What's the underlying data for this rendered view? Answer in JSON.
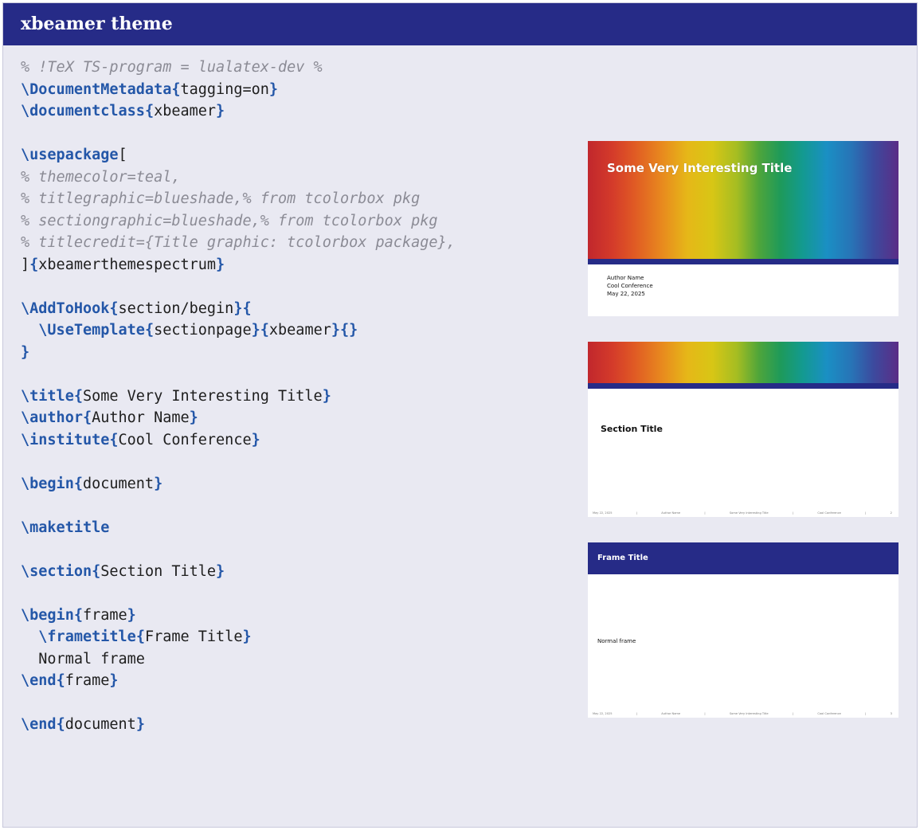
{
  "box": {
    "title": "xbeamer theme"
  },
  "code": {
    "lines": [
      [
        [
          "cm",
          "% !TeX TS-program = lualatex-dev %"
        ]
      ],
      [
        [
          "kw",
          "\\DocumentMetadata"
        ],
        [
          "br",
          "{"
        ],
        [
          "tx",
          "tagging=on"
        ],
        [
          "br",
          "}"
        ]
      ],
      [
        [
          "kw",
          "\\documentclass"
        ],
        [
          "br",
          "{"
        ],
        [
          "tx",
          "xbeamer"
        ],
        [
          "br",
          "}"
        ]
      ],
      [],
      [
        [
          "kw",
          "\\usepackage"
        ],
        [
          "tx",
          "["
        ]
      ],
      [
        [
          "cm",
          "% themecolor=teal,"
        ]
      ],
      [
        [
          "cm",
          "% titlegraphic=blueshade,% from tcolorbox pkg"
        ]
      ],
      [
        [
          "cm",
          "% sectiongraphic=blueshade,% from tcolorbox pkg"
        ]
      ],
      [
        [
          "cm",
          "% titlecredit={Title graphic: tcolorbox package},"
        ]
      ],
      [
        [
          "tx",
          "]"
        ],
        [
          "br",
          "{"
        ],
        [
          "tx",
          "xbeamerthemespectrum"
        ],
        [
          "br",
          "}"
        ]
      ],
      [],
      [
        [
          "kw",
          "\\AddToHook"
        ],
        [
          "br",
          "{"
        ],
        [
          "tx",
          "section/begin"
        ],
        [
          "br",
          "}{"
        ]
      ],
      [
        [
          "tx",
          "  "
        ],
        [
          "kw",
          "\\UseTemplate"
        ],
        [
          "br",
          "{"
        ],
        [
          "tx",
          "sectionpage"
        ],
        [
          "br",
          "}{"
        ],
        [
          "tx",
          "xbeamer"
        ],
        [
          "br",
          "}{}"
        ]
      ],
      [
        [
          "br",
          "}"
        ]
      ],
      [],
      [
        [
          "kw",
          "\\title"
        ],
        [
          "br",
          "{"
        ],
        [
          "tx",
          "Some Very Interesting Title"
        ],
        [
          "br",
          "}"
        ]
      ],
      [
        [
          "kw",
          "\\author"
        ],
        [
          "br",
          "{"
        ],
        [
          "tx",
          "Author Name"
        ],
        [
          "br",
          "}"
        ]
      ],
      [
        [
          "kw",
          "\\institute"
        ],
        [
          "br",
          "{"
        ],
        [
          "tx",
          "Cool Conference"
        ],
        [
          "br",
          "}"
        ]
      ],
      [],
      [
        [
          "kw",
          "\\begin"
        ],
        [
          "br",
          "{"
        ],
        [
          "tx",
          "document"
        ],
        [
          "br",
          "}"
        ]
      ],
      [],
      [
        [
          "kw",
          "\\maketitle"
        ]
      ],
      [],
      [
        [
          "kw",
          "\\section"
        ],
        [
          "br",
          "{"
        ],
        [
          "tx",
          "Section Title"
        ],
        [
          "br",
          "}"
        ]
      ],
      [],
      [
        [
          "kw",
          "\\begin"
        ],
        [
          "br",
          "{"
        ],
        [
          "tx",
          "frame"
        ],
        [
          "br",
          "}"
        ]
      ],
      [
        [
          "tx",
          "  "
        ],
        [
          "kw",
          "\\frametitle"
        ],
        [
          "br",
          "{"
        ],
        [
          "tx",
          "Frame Title"
        ],
        [
          "br",
          "}"
        ]
      ],
      [
        [
          "tx",
          "  Normal frame"
        ]
      ],
      [
        [
          "kw",
          "\\end"
        ],
        [
          "br",
          "{"
        ],
        [
          "tx",
          "frame"
        ],
        [
          "br",
          "}"
        ]
      ],
      [],
      [
        [
          "kw",
          "\\end"
        ],
        [
          "br",
          "{"
        ],
        [
          "tx",
          "document"
        ],
        [
          "br",
          "}"
        ]
      ]
    ]
  },
  "slides": {
    "title_slide": {
      "title": "Some Very Interesting Title",
      "author": "Author Name",
      "institute": "Cool Conference",
      "date": "May 22, 2025"
    },
    "section_slide": {
      "title": "Section Title",
      "footer": [
        "May 22, 2025",
        "|",
        "Author Name",
        "|",
        "Some Very Interesting Title",
        "|",
        "Cool Conference",
        "|",
        "2"
      ]
    },
    "frame_slide": {
      "title": "Frame Title",
      "body": "Normal frame",
      "footer": [
        "May 22, 2025",
        "|",
        "Author Name",
        "|",
        "Some Very Interesting Title",
        "|",
        "Cool Conference",
        "|",
        "3"
      ]
    }
  },
  "colors": {
    "header_navy": "#262b87",
    "box_background": "#e9e9f2",
    "code_keyword": "#2457a8",
    "code_comment": "#8b8b95"
  }
}
